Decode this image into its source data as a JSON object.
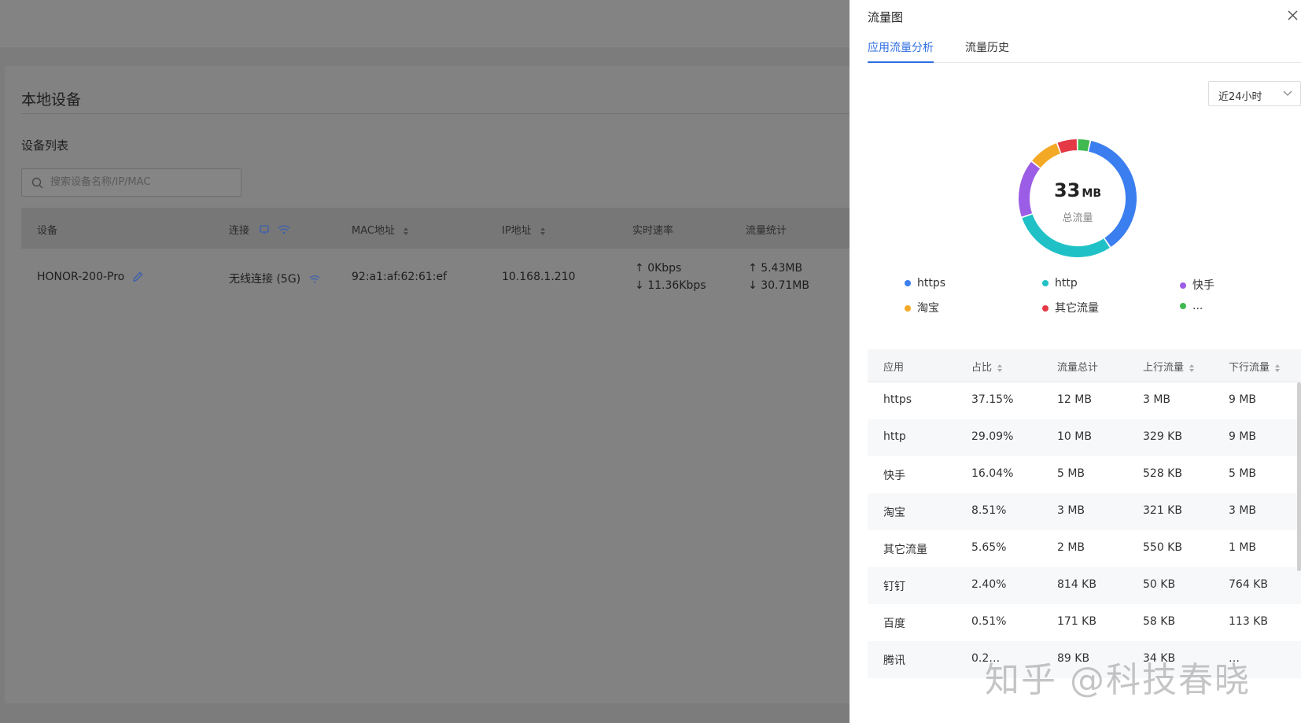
{
  "page": {
    "title": "本地设备",
    "section_title": "设备列表",
    "search_placeholder": "搜索设备名称/IP/MAC",
    "columns": [
      "设备",
      "连接",
      "MAC地址",
      "IP地址",
      "实时速率",
      "流量统计"
    ],
    "device": {
      "name": "HONOR-200-Pro",
      "connection": "无线连接 (5G)",
      "mac": "92:a1:af:62:61:ef",
      "ip": "10.168.1.210",
      "rate_up": "0Kbps",
      "rate_down": "11.36Kbps",
      "traffic_up": "5.43MB",
      "traffic_down": "30.71MB"
    }
  },
  "drawer": {
    "title": "流量图",
    "tabs": [
      {
        "label": "应用流量分析",
        "active": true
      },
      {
        "label": "流量历史",
        "active": false
      }
    ],
    "range": "近24小时",
    "total_value": "33",
    "total_unit": "MB",
    "total_label": "总流量",
    "legend": [
      {
        "label": "https",
        "color": "#3b7ef0"
      },
      {
        "label": "http",
        "color": "#1fc1c6"
      },
      {
        "label": "快手",
        "color": "#9b5de5"
      },
      {
        "label": "淘宝",
        "color": "#f4a926"
      },
      {
        "label": "其它流量",
        "color": "#e63946"
      },
      {
        "label": "...",
        "color": "#3fb950"
      }
    ],
    "chart_data": {
      "type": "pie",
      "categories": [
        "https",
        "http",
        "快手",
        "淘宝",
        "其它流量",
        "..."
      ],
      "values": [
        37.15,
        29.09,
        16.04,
        8.51,
        5.65,
        3.56
      ],
      "colors": [
        "#3b7ef0",
        "#1fc1c6",
        "#9b5de5",
        "#f4a926",
        "#e63946",
        "#3fb950"
      ]
    },
    "table": {
      "headers": [
        "应用",
        "占比",
        "流量总计",
        "上行流量",
        "下行流量"
      ],
      "rows": [
        [
          "https",
          "37.15%",
          "12 MB",
          "3 MB",
          "9 MB"
        ],
        [
          "http",
          "29.09%",
          "10 MB",
          "329 KB",
          "9 MB"
        ],
        [
          "快手",
          "16.04%",
          "5 MB",
          "528 KB",
          "5 MB"
        ],
        [
          "淘宝",
          "8.51%",
          "3 MB",
          "321 KB",
          "3 MB"
        ],
        [
          "其它流量",
          "5.65%",
          "2 MB",
          "550 KB",
          "1 MB"
        ],
        [
          "钉钉",
          "2.40%",
          "814 KB",
          "50 KB",
          "764 KB"
        ],
        [
          "百度",
          "0.51%",
          "171 KB",
          "58 KB",
          "113 KB"
        ],
        [
          "腾讯",
          "0.2…",
          "89 KB",
          "34 KB",
          "…"
        ]
      ]
    },
    "watermark": "知乎 @科技春晓"
  }
}
